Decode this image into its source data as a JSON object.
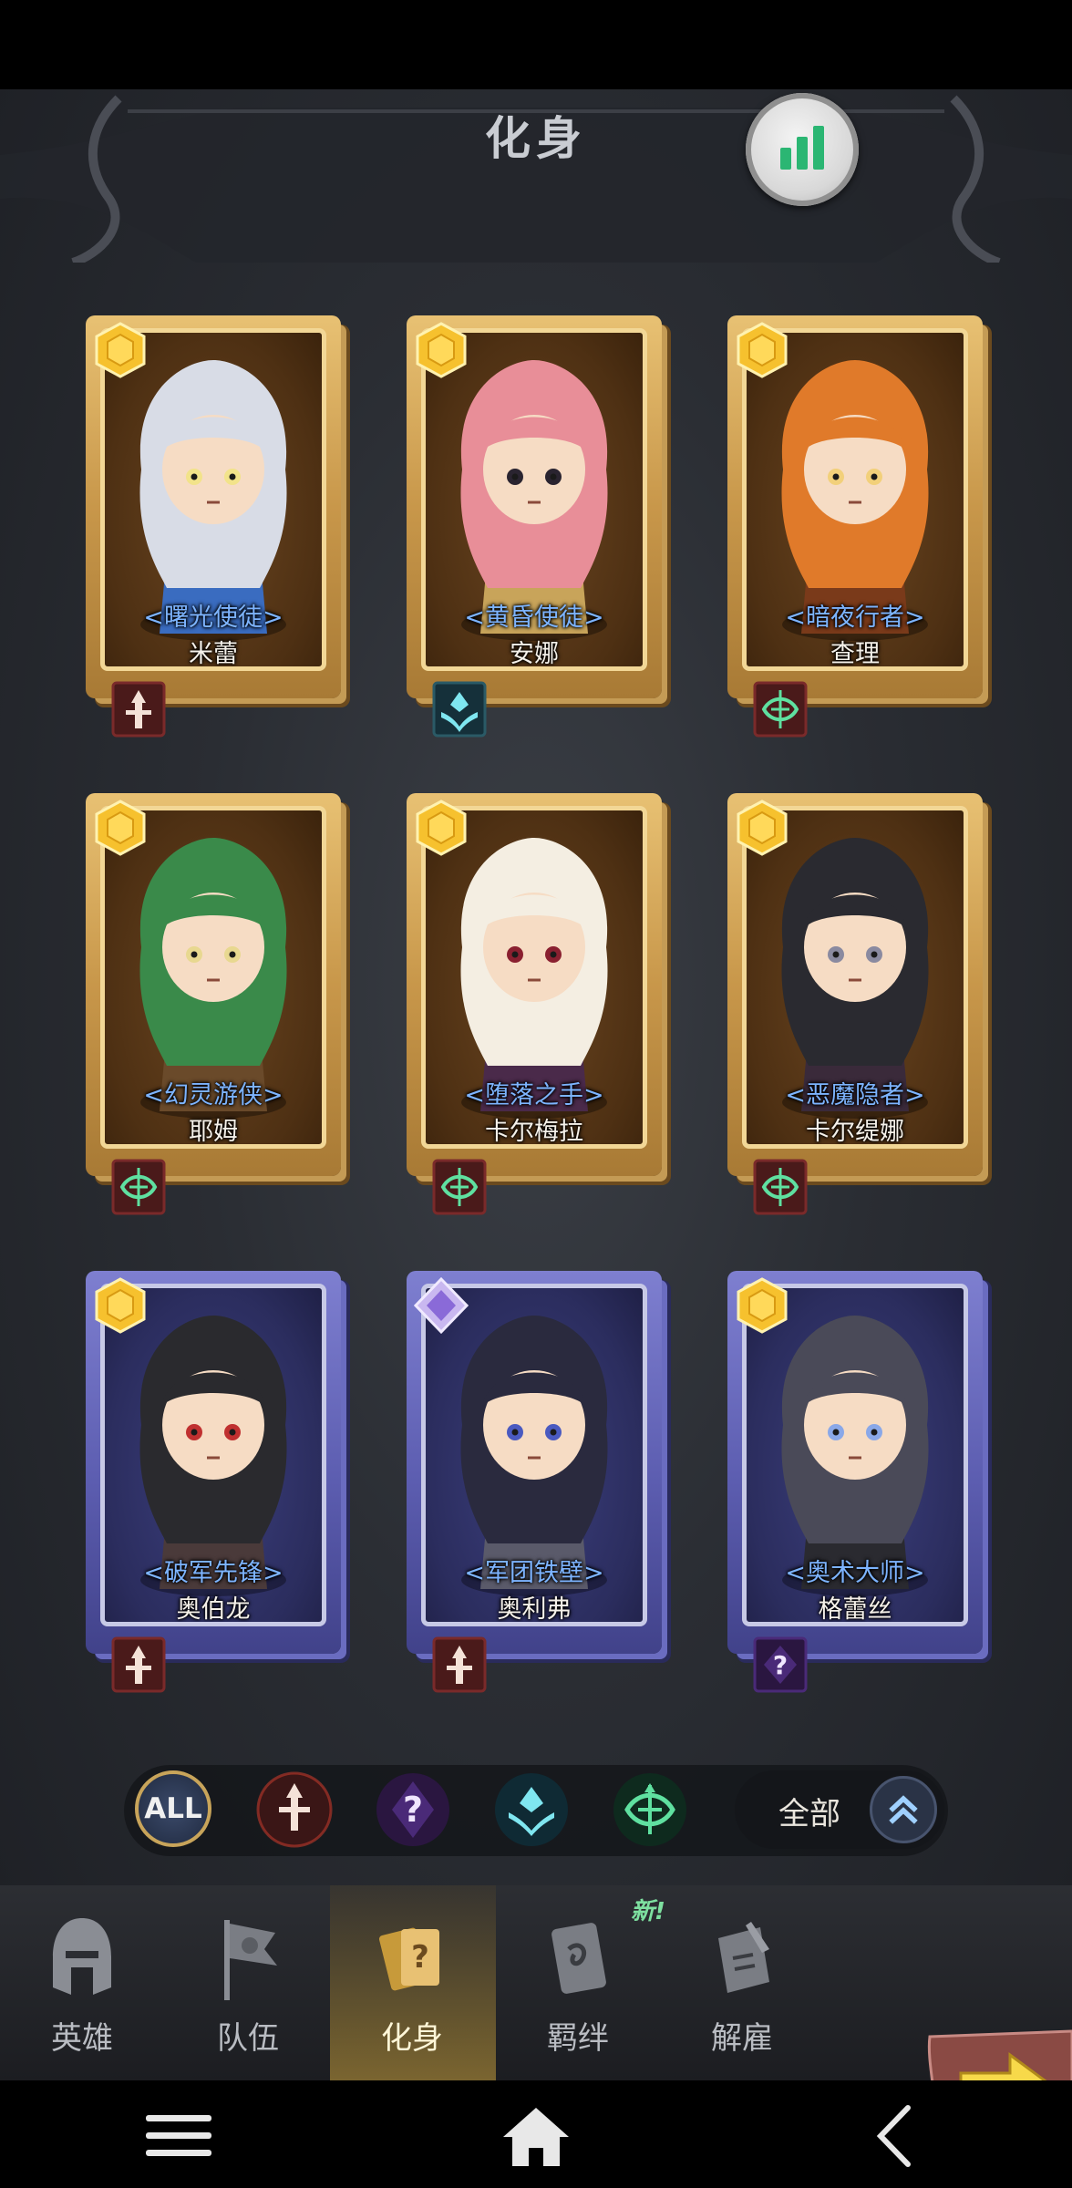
{
  "header": {
    "title": "化身",
    "stats_button_icon": "bar-chart-icon"
  },
  "cards": [
    {
      "role": "<曙光使徒>",
      "name": "米蕾",
      "frame": "gold",
      "rarity": "gold-gem",
      "class": "warrior-class-icon"
    },
    {
      "role": "<黄昏使徒>",
      "name": "安娜",
      "frame": "gold",
      "rarity": "gold-gem",
      "class": "priest-class-icon"
    },
    {
      "role": "<暗夜行者>",
      "name": "查理",
      "frame": "gold",
      "rarity": "gold-gem",
      "class": "ranger-class-icon"
    },
    {
      "role": "<幻灵游侠>",
      "name": "耶姆",
      "frame": "gold",
      "rarity": "gold-gem",
      "class": "ranger-class-icon"
    },
    {
      "role": "<堕落之手>",
      "name": "卡尔梅拉",
      "frame": "gold",
      "rarity": "gold-gem",
      "class": "ranger-class-icon"
    },
    {
      "role": "<恶魔隐者>",
      "name": "卡尔缇娜",
      "frame": "gold",
      "rarity": "gold-gem",
      "class": "ranger-class-icon"
    },
    {
      "role": "<破军先锋>",
      "name": "奥伯龙",
      "frame": "blue",
      "rarity": "gold-gem",
      "class": "warrior-class-icon"
    },
    {
      "role": "<军团铁壁>",
      "name": "奥利弗",
      "frame": "blue",
      "rarity": "purple-gem",
      "class": "warrior-class-icon"
    },
    {
      "role": "<奥术大师>",
      "name": "格蕾丝",
      "frame": "blue",
      "rarity": "gold-gem",
      "class": "mage-class-icon"
    }
  ],
  "filters": {
    "all_label": "ALL",
    "icons": [
      "warrior-filter-icon",
      "mage-filter-icon",
      "priest-filter-icon",
      "ranger-filter-icon"
    ],
    "dropdown_label": "全部",
    "dropdown_icon": "double-chevron-up-icon"
  },
  "tabs": [
    {
      "label": "英雄",
      "icon": "helmet-icon"
    },
    {
      "label": "队伍",
      "icon": "flag-icon"
    },
    {
      "label": "化身",
      "icon": "cards-icon",
      "active": true
    },
    {
      "label": "羁绊",
      "icon": "scroll-icon"
    },
    {
      "label": "解雇",
      "icon": "dismiss-scroll-icon"
    }
  ],
  "new_badge": "新!",
  "colors": {
    "accent_gold": "#e8c173",
    "accent_blue": "#7e7fd0",
    "role_text": "#7db4ff"
  },
  "system_nav": {
    "menu": "menu-icon",
    "home": "home-icon",
    "back": "back-icon"
  }
}
